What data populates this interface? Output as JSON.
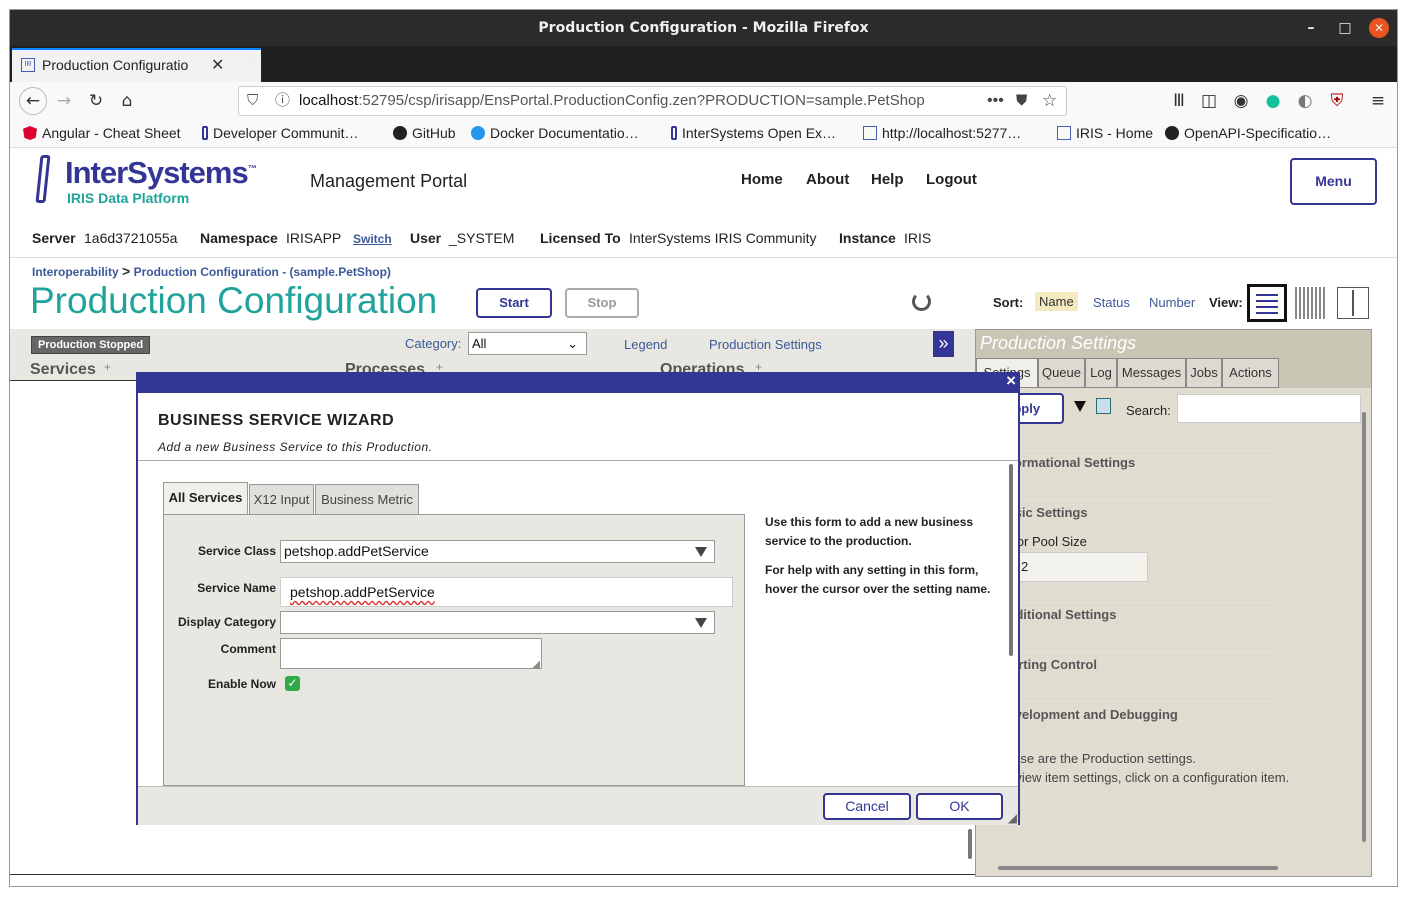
{
  "browser": {
    "window_title": "Production Configuration - Mozilla Firefox",
    "tab_title": "Production Configuratio",
    "url_host": "localhost",
    "url_rest": ":52795/csp/irisapp/EnsPortal.ProductionConfig.zen?PRODUCTION=sample.PetShop",
    "bookmarks": [
      {
        "label": "Angular - Cheat Sheet",
        "icon": "angular-icon"
      },
      {
        "label": "Developer Communit…",
        "icon": "intersystems-icon"
      },
      {
        "label": "GitHub",
        "icon": "github-icon"
      },
      {
        "label": "Docker Documentatio…",
        "icon": "docker-icon"
      },
      {
        "label": "InterSystems Open Ex…",
        "icon": "intersystems-icon"
      },
      {
        "label": "http://localhost:5277…",
        "icon": "iris-icon"
      },
      {
        "label": "IRIS - Home",
        "icon": "iris-icon"
      },
      {
        "label": "OpenAPI-Specificatio…",
        "icon": "github-icon"
      }
    ]
  },
  "header": {
    "brand": "InterSystems",
    "brand_tm": "™",
    "brand_sub": "IRIS Data Platform",
    "portal_title": "Management Portal",
    "nav": {
      "home": "Home",
      "about": "About",
      "help": "Help",
      "logout": "Logout"
    },
    "menu_button": "Menu",
    "server_label": "Server",
    "server_value": "1a6d3721055a",
    "namespace_label": "Namespace",
    "namespace_value": "IRISAPP",
    "switch_link": "Switch",
    "user_label": "User",
    "user_value": "_SYSTEM",
    "licensed_label": "Licensed To",
    "licensed_value": "InterSystems IRIS Community",
    "instance_label": "Instance",
    "instance_value": "IRIS"
  },
  "breadcrumb": {
    "item1": "Interoperability",
    "sep": ">",
    "item2": "Production Configuration",
    "item3": "- (sample.PetShop)"
  },
  "page": {
    "title": "Production Configuration",
    "start_button": "Start",
    "stop_button": "Stop",
    "sort_label": "Sort:",
    "sort_options": [
      "Name",
      "Status",
      "Number"
    ],
    "view_label": "View:",
    "status_badge": "Production Stopped",
    "category_label": "Category:",
    "category_value": "All",
    "legend_link": "Legend",
    "production_settings_link": "Production Settings",
    "expand_glyph": "»",
    "col_services": "Services",
    "col_processes": "Processes",
    "col_operations": "Operations",
    "add_glyph": "+"
  },
  "settings_panel": {
    "title": "Production Settings",
    "tabs": [
      "Settings",
      "Queue",
      "Log",
      "Messages",
      "Jobs",
      "Actions"
    ],
    "apply_button": "Apply",
    "search_label": "Search:",
    "sections": [
      "Informational Settings",
      "Basic Settings",
      "Additional Settings",
      "Alerting Control",
      "Development and Debugging"
    ],
    "actor_pool_label": "Actor Pool Size",
    "actor_pool_value": "2",
    "info_line1": "These are the Production settings.",
    "info_line2": "To view item settings, click on a configuration item."
  },
  "wizard": {
    "title": "BUSINESS SERVICE WIZARD",
    "subtitle": "Add a new Business Service to this Production.",
    "tabs": [
      "All Services",
      "X12 Input",
      "Business Metric"
    ],
    "service_class_label": "Service Class",
    "service_class_value": "petshop.addPetService",
    "service_name_label": "Service Name",
    "service_name_value": "petshop.addPetService",
    "display_category_label": "Display Category",
    "display_category_value": "",
    "comment_label": "Comment",
    "comment_value": "",
    "enable_now_label": "Enable Now",
    "enable_now_checked": true,
    "help1": "Use this form to add a new business service to the production.",
    "help2": "For help with any setting in this form, hover the cursor over the setting name.",
    "cancel_button": "Cancel",
    "ok_button": "OK",
    "close_glyph": "×"
  },
  "colors": {
    "brand_teal": "#1fa39b",
    "brand_navy": "#333695",
    "link_blue": "#3b5998"
  }
}
